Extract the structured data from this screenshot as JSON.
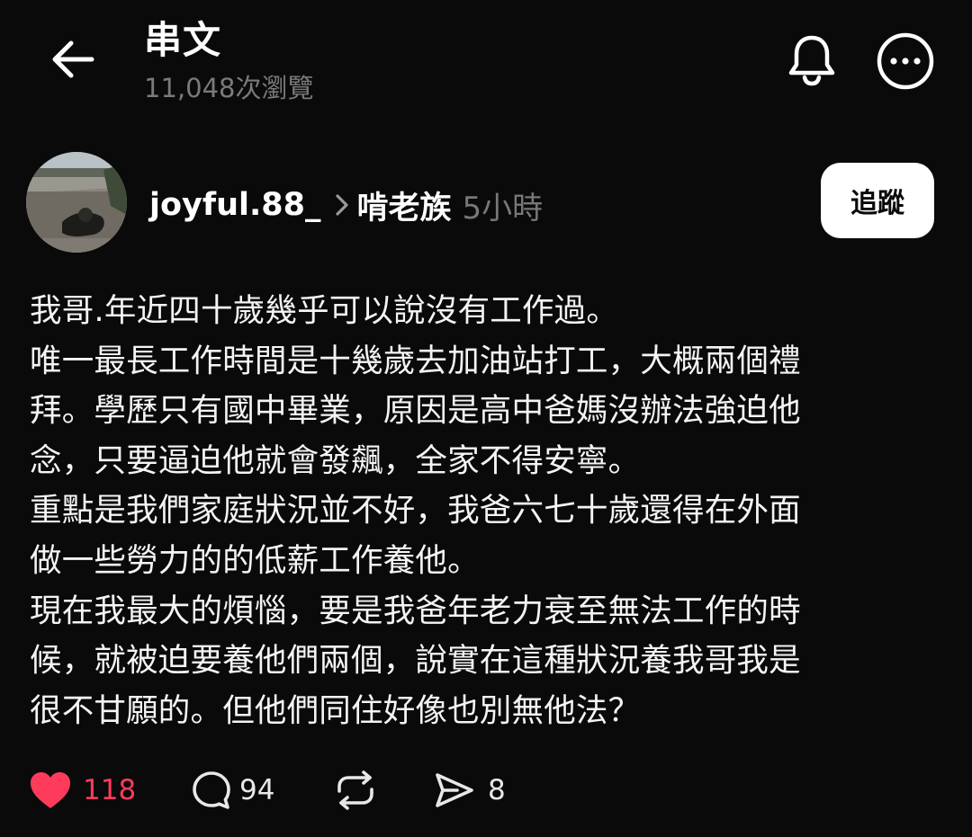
{
  "header": {
    "title": "串文",
    "views": "11,048次瀏覽"
  },
  "post": {
    "author": "joyful.88_",
    "community": "啃老族",
    "time": "5小時",
    "follow_label": "追蹤",
    "lines": [
      "我哥.年近四十歲幾乎可以說沒有工作過。",
      "唯一最長工作時間是十幾歲去加油站打工，大概兩個禮",
      "拜。學歷只有國中畢業，原因是高中爸媽沒辦法強迫他",
      "念，只要逼迫他就會發飆，全家不得安寧。",
      "重點是我們家庭狀況並不好，我爸六七十歲還得在外面",
      "做一些勞力的的低薪工作養他。",
      "現在我最大的煩惱，要是我爸年老力衰至無法工作的時",
      "候，就被迫要養他們兩個，說實在這種狀況養我哥我是",
      "很不甘願的。但他們同住好像也別無他法？"
    ]
  },
  "actions": {
    "likes": "118",
    "replies": "94",
    "shares": "8"
  },
  "colors": {
    "background": "#0a0a0a",
    "like_active": "#ff3b5c",
    "muted": "#777777"
  },
  "icons": [
    "back-arrow-icon",
    "bell-icon",
    "more-icon",
    "chevron-right-icon",
    "heart-icon",
    "comment-icon",
    "repost-icon",
    "share-icon"
  ]
}
